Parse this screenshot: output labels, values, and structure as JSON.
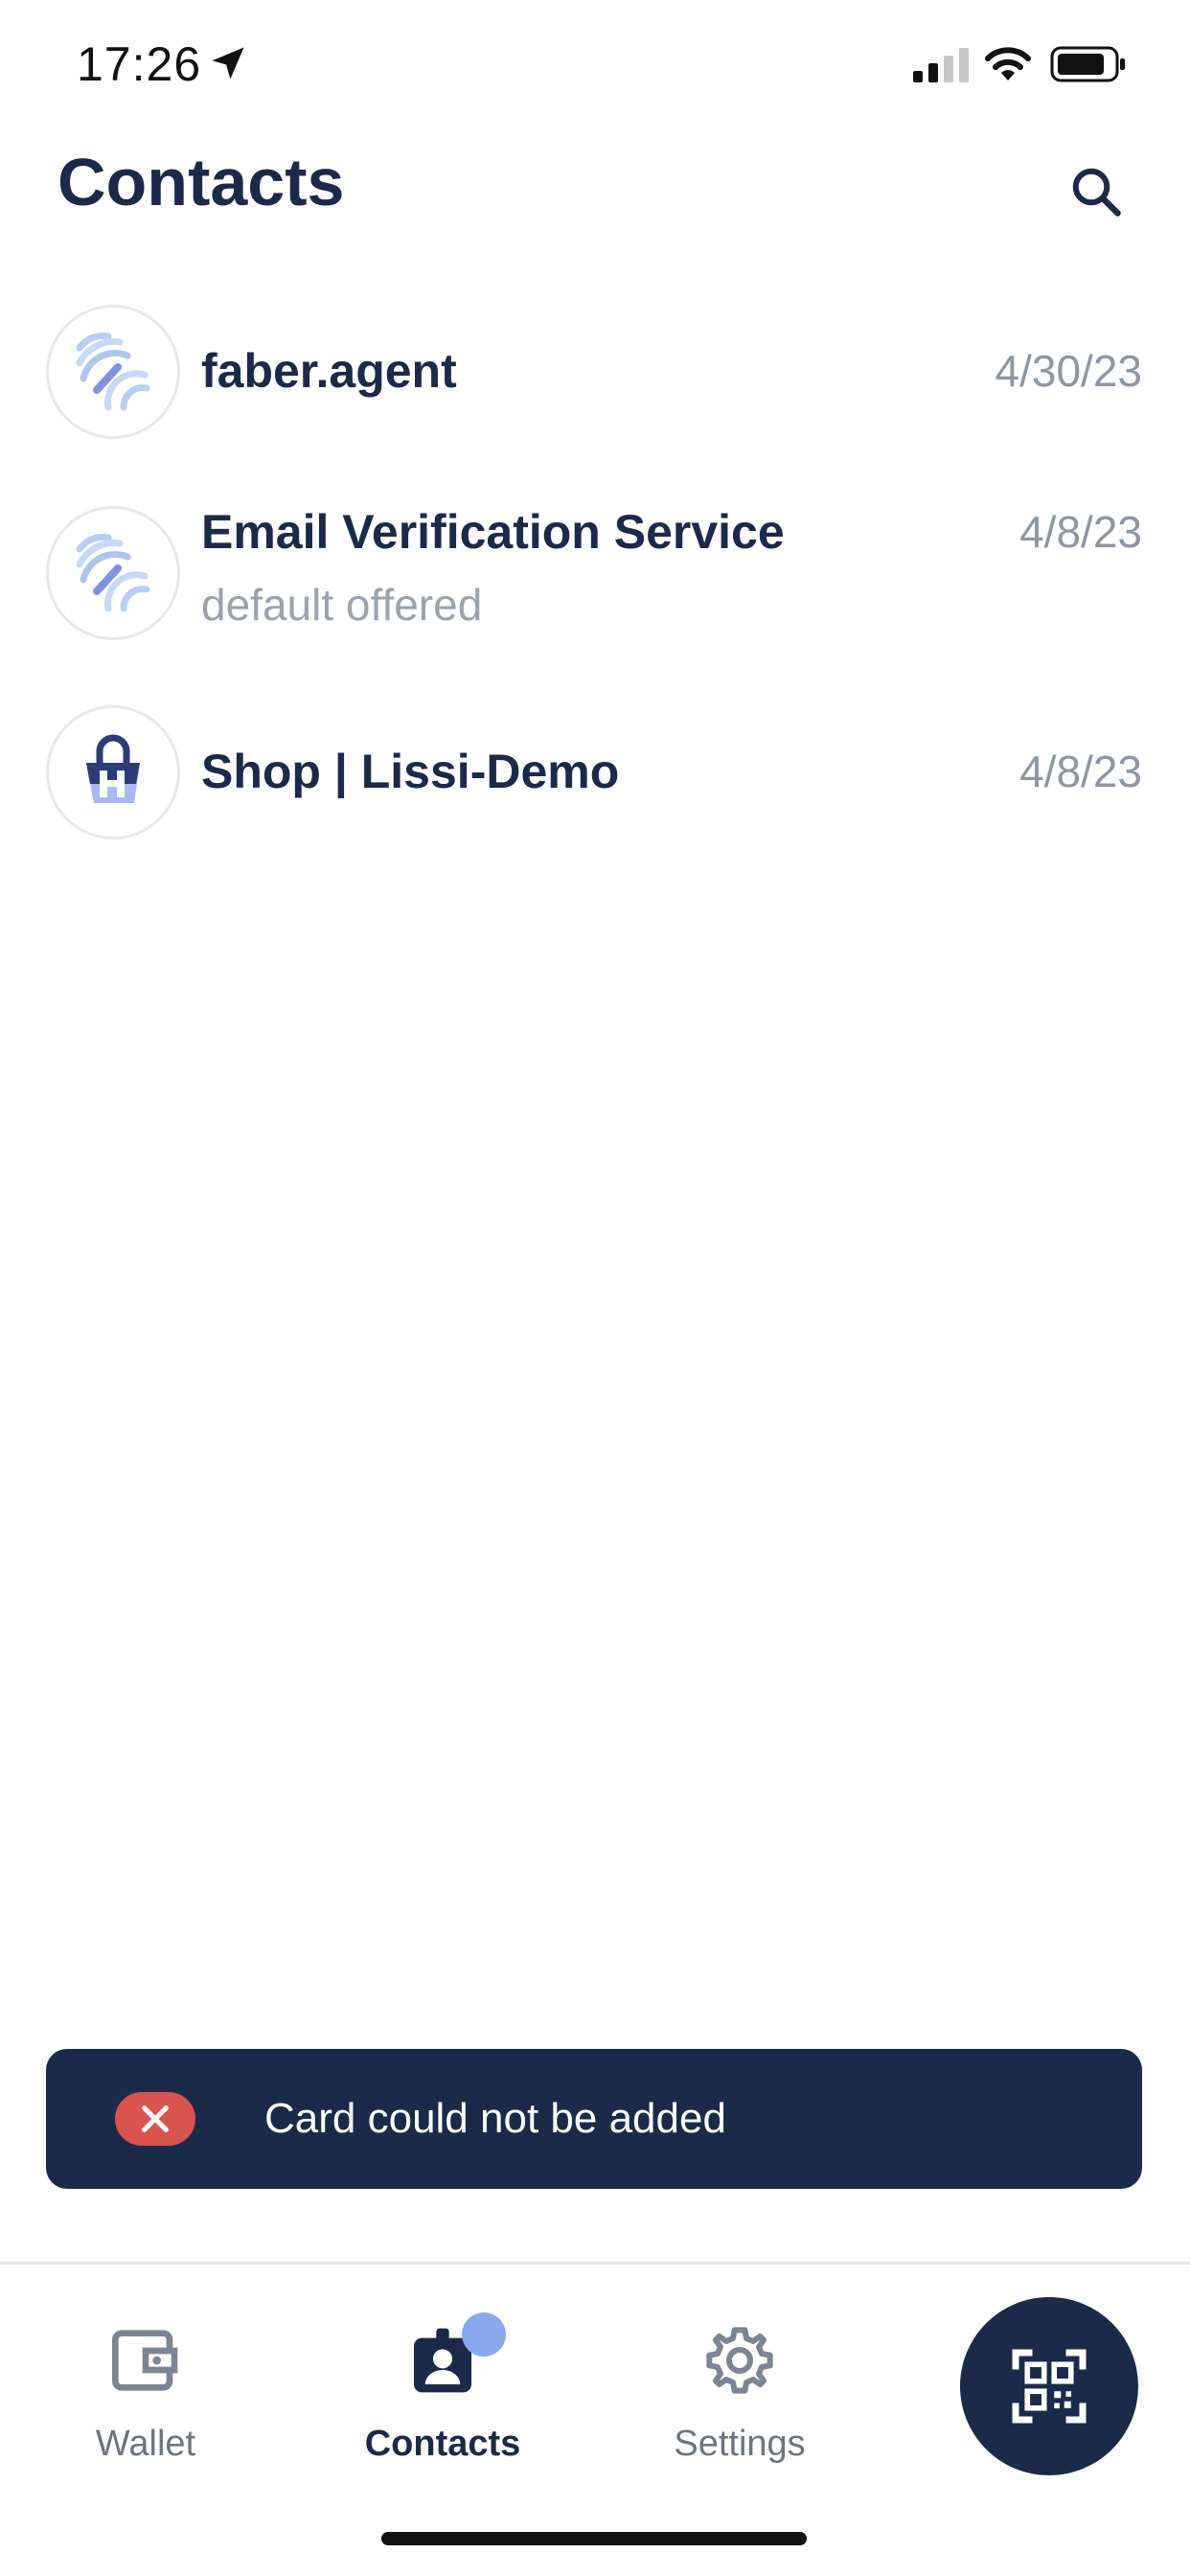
{
  "status_bar": {
    "time": "17:26",
    "icons": [
      "location-arrow-icon",
      "cellular-signal-icon",
      "wifi-icon",
      "battery-icon"
    ]
  },
  "header": {
    "title": "Contacts",
    "search_icon": "search-icon"
  },
  "contacts": [
    {
      "name": "faber.agent",
      "subtitle": "",
      "date": "4/30/23",
      "avatar_icon": "agent-logo-icon"
    },
    {
      "name": "Email Verification Service",
      "subtitle": "default offered",
      "date": "4/8/23",
      "avatar_icon": "agent-logo-icon"
    },
    {
      "name": "Shop | Lissi-Demo",
      "subtitle": "",
      "date": "4/8/23",
      "avatar_icon": "shopping-basket-icon"
    }
  ],
  "toast": {
    "message": "Card could not be added",
    "icon": "close-icon",
    "color": "#d9534f"
  },
  "tabbar": {
    "tabs": [
      {
        "label": "Wallet",
        "icon": "wallet-icon",
        "active": false
      },
      {
        "label": "Contacts",
        "icon": "contact-badge-icon",
        "active": true,
        "has_badge": true
      },
      {
        "label": "Settings",
        "icon": "gear-icon",
        "active": false
      }
    ],
    "scan_icon": "qr-scan-icon"
  },
  "colors": {
    "primary": "#1b2a48",
    "muted": "#8e96a3",
    "error": "#d9534f",
    "badge": "#8aa8f0"
  }
}
